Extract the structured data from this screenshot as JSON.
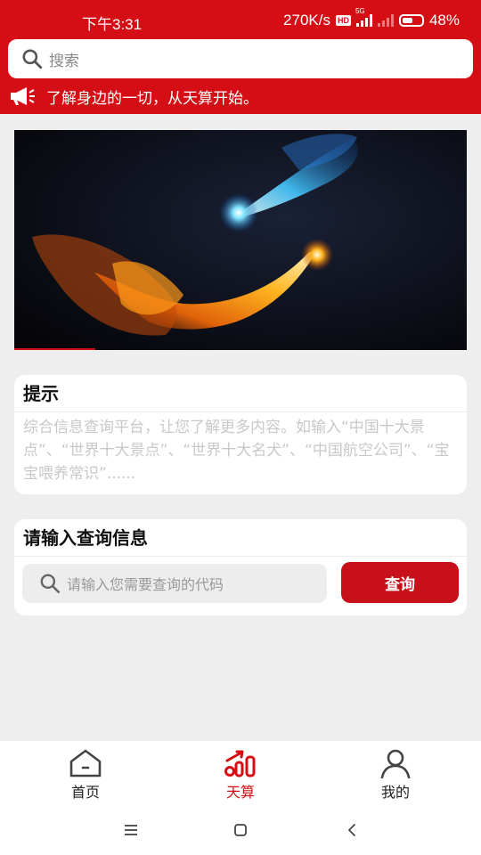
{
  "status_bar": {
    "time": "下午3:31",
    "net_speed": "270K/s",
    "hd_badge": "HD",
    "network_tag": "5G",
    "battery": "48%"
  },
  "header": {
    "search_placeholder": "搜索",
    "notice_text": "了解身边的一切，从天算开始。"
  },
  "video": {
    "progress": 0.18
  },
  "tip_card": {
    "title": "提示",
    "text": "综合信息查询平台，让您了解更多内容。如输入“中国十大景点”、“世界十大景点”、“世界十大名犬”、“中国航空公司”、“宝宝喂养常识”......"
  },
  "query_card": {
    "title": "请输入查询信息",
    "input_placeholder": "请输入您需要查询的代码",
    "button_label": "查询"
  },
  "tabbar": {
    "items": [
      {
        "label": "首页",
        "icon": "home-icon",
        "active": false
      },
      {
        "label": "天算",
        "icon": "chart-icon",
        "active": true
      },
      {
        "label": "我的",
        "icon": "user-icon",
        "active": false
      }
    ]
  },
  "colors": {
    "brand_red": "#d50e15",
    "background": "#eeeeee"
  }
}
